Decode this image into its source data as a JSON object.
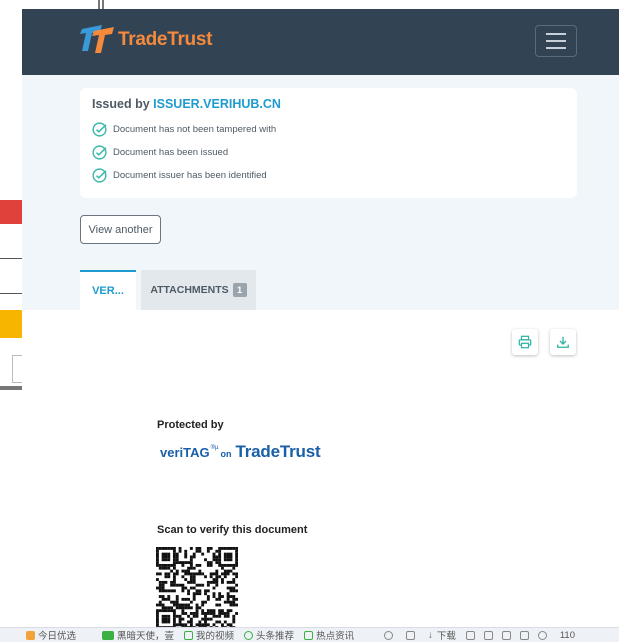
{
  "header": {
    "brand_name": "TradeTrust",
    "colors": {
      "navbar": "#324353",
      "brand": "#f58a3c",
      "accent": "#1f9bcf"
    }
  },
  "status": {
    "issued_by_prefix": "Issued by",
    "issuer": "ISSUER.VERIHUB.CN",
    "checks": [
      {
        "text": "Document has not been tampered with",
        "icon": "check-circle-icon"
      },
      {
        "text": "Document has been issued",
        "icon": "check-circle-icon"
      },
      {
        "text": "Document issuer has been identified",
        "icon": "check-circle-icon"
      }
    ],
    "view_another_label": "View another"
  },
  "tabs": {
    "verify_label": "VER...",
    "attachments_label": "ATTACHMENTS",
    "attachments_count": "1"
  },
  "document": {
    "protected_by": "Protected by",
    "veritag_veri": "veri",
    "veritag_tag": "TAG",
    "veritag_sup": "®µ",
    "veritag_on": "on",
    "veritag_tt": "TradeTrust",
    "scan_label": "Scan to verify this document"
  },
  "taskbar": {
    "items": [
      "今日优选",
      "黑暗天使，壹",
      "我的视频",
      "头条推荐",
      "热点资讯",
      "下载",
      "110"
    ]
  }
}
